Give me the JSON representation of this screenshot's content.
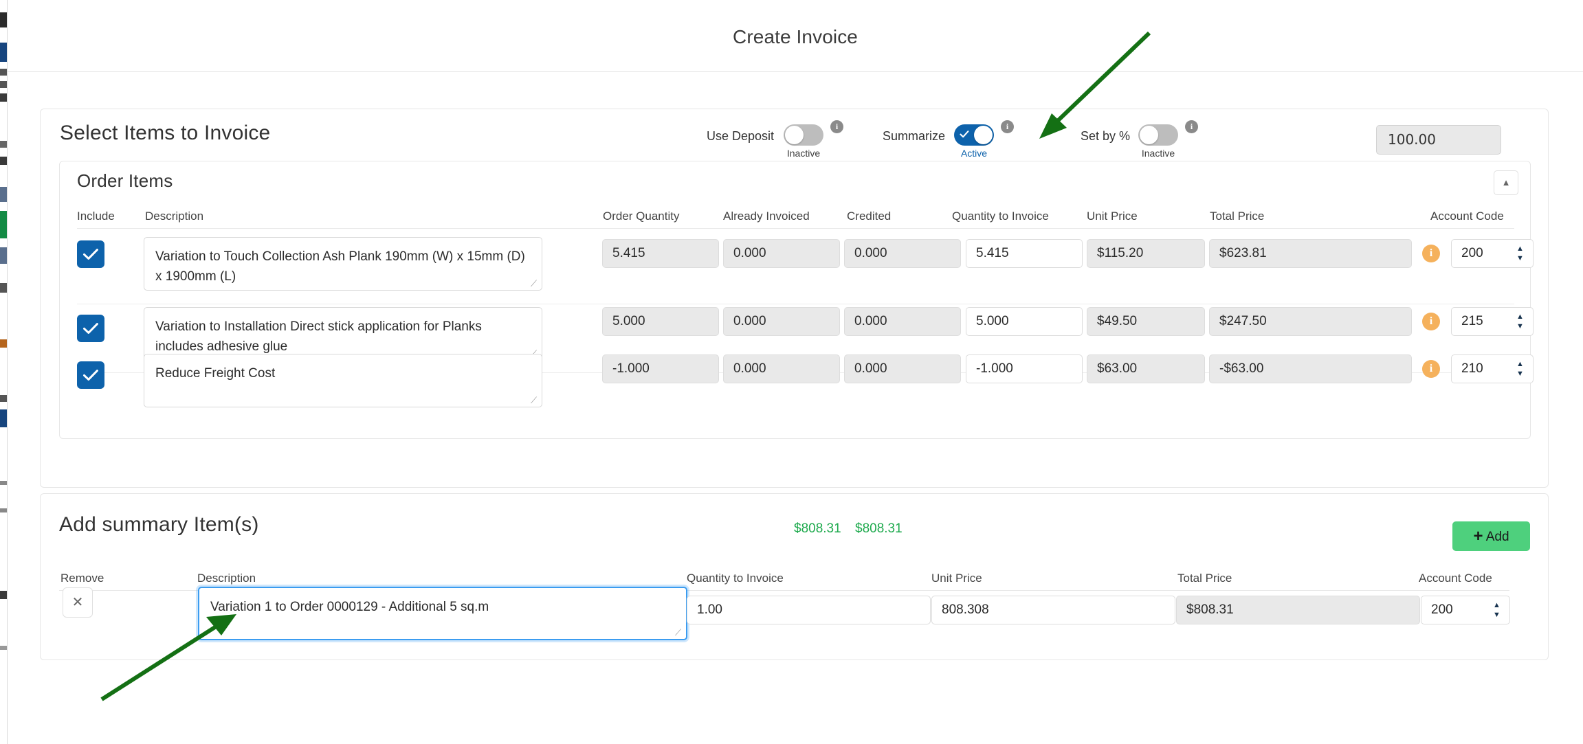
{
  "modal": {
    "title": "Create Invoice"
  },
  "select_section": {
    "heading": "Select Items to Invoice",
    "toggles": [
      {
        "label": "Use Deposit",
        "state": "Inactive",
        "active": false,
        "info": "info-icon"
      },
      {
        "label": "Summarize",
        "state": "Active",
        "active": true,
        "info": "info-icon"
      },
      {
        "label": "Set by %",
        "state": "Inactive",
        "active": false,
        "info": "info-icon"
      }
    ],
    "percent_value": "100.00"
  },
  "order_items": {
    "heading": "Order Items",
    "collapse_icon": "chevron-up-icon",
    "columns": [
      "Include",
      "Description",
      "Order Quantity",
      "Already Invoiced",
      "Credited",
      "Quantity to Invoice",
      "Unit Price",
      "Total Price",
      "",
      "Account Code"
    ],
    "rows": [
      {
        "include": true,
        "description": "Variation to Touch Collection Ash Plank 190mm (W) x 15mm (D) x 1900mm (L)",
        "order_quantity": "5.415",
        "already_invoiced": "0.000",
        "credited": "0.000",
        "quantity_to_invoice": "5.415",
        "unit_price": "$115.20",
        "total_price": "$623.81",
        "account_code": "200"
      },
      {
        "include": true,
        "description": "Variation to Installation Direct stick application for Planks includes adhesive glue",
        "order_quantity": "5.000",
        "already_invoiced": "0.000",
        "credited": "0.000",
        "quantity_to_invoice": "5.000",
        "unit_price": "$49.50",
        "total_price": "$247.50",
        "account_code": "215"
      },
      {
        "include": true,
        "description": "Reduce Freight Cost",
        "order_quantity": "-1.000",
        "already_invoiced": "0.000",
        "credited": "0.000",
        "quantity_to_invoice": "-1.000",
        "unit_price": "$63.00",
        "total_price": "-$63.00",
        "account_code": "210"
      }
    ]
  },
  "summary_section": {
    "heading": "Add summary Item(s)",
    "total_left": "$808.31",
    "total_right": "$808.31",
    "add_label": "Add",
    "add_icon": "plus-icon",
    "columns": [
      "Remove",
      "Description",
      "Quantity to Invoice",
      "Unit Price",
      "Total Price",
      "Account Code"
    ],
    "rows": [
      {
        "remove_icon": "close-icon",
        "description": "Variation 1 to Order 0000129 - Additional 5 sq.m",
        "quantity_to_invoice": "1.00",
        "unit_price": "808.308",
        "total_price": "$808.31",
        "account_code": "200"
      }
    ]
  },
  "colors": {
    "toggle_on": "#0d62ab",
    "checkbox": "#0d62ab",
    "add_button": "#4ed07d",
    "total_green": "#1faa4e",
    "info_orange": "#f5b15c",
    "annotation_arrow": "#147014"
  }
}
